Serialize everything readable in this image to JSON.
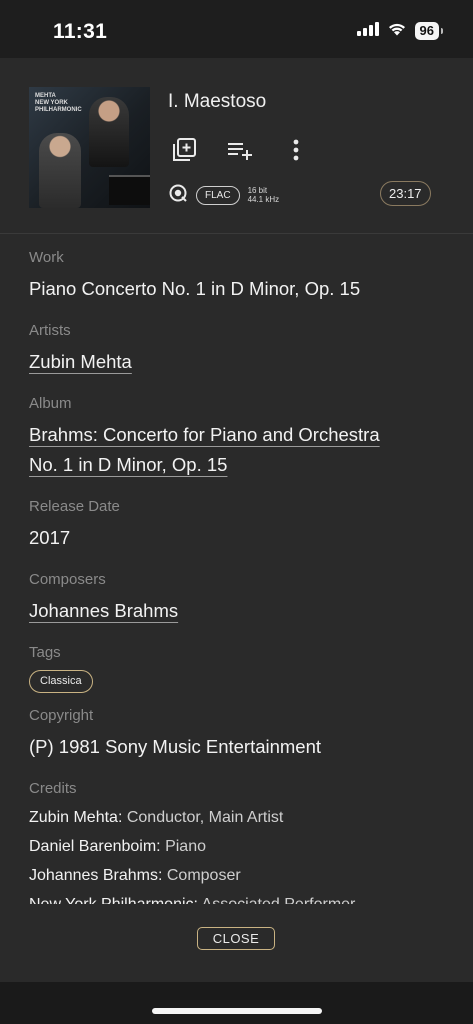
{
  "status_bar": {
    "time": "11:31",
    "battery": "96"
  },
  "track": {
    "title": "I. Maestoso",
    "format": "FLAC",
    "bit_depth": "16 bit",
    "sample_rate": "44.1 kHz",
    "duration": "23:17",
    "album_art_text": "MEHTA NEW YORK PHILHARMONIC BARENBOIM BRAHMS PIANO CONCERTO 1"
  },
  "details": {
    "work": {
      "label": "Work",
      "value": "Piano Concerto No. 1 in D Minor, Op. 15"
    },
    "artists": {
      "label": "Artists",
      "value": "Zubin Mehta"
    },
    "album": {
      "label": "Album",
      "value_line1": "Brahms: Concerto for Piano and Orchestra",
      "value_line2": "No. 1 in D Minor, Op. 15"
    },
    "release_date": {
      "label": "Release Date",
      "value": "2017"
    },
    "composers": {
      "label": "Composers",
      "value": "Johannes Brahms"
    },
    "tags": {
      "label": "Tags",
      "items": [
        "Classica"
      ]
    },
    "copyright": {
      "label": "Copyright",
      "value": "(P) 1981 Sony Music Entertainment"
    },
    "credits": {
      "label": "Credits",
      "items": [
        {
          "name": "Zubin Mehta:",
          "role": "Conductor, Main Artist"
        },
        {
          "name": "Daniel Barenboim:",
          "role": "Piano"
        },
        {
          "name": "Johannes Brahms:",
          "role": "Composer"
        },
        {
          "name": "New York Philharmonic:",
          "role": "Associated Performer"
        }
      ]
    }
  },
  "close_button": "CLOSE",
  "colors": {
    "background": "#2a2a2a",
    "accent_gold": "#c9b383",
    "label_gray": "#8a8a8a",
    "text": "#f2f2f2"
  },
  "icons": {
    "add_to_playlist": "library-add-icon",
    "add_to_queue": "playlist-add-icon",
    "more": "more-vertical-icon",
    "quality": "hi-res-disc-icon"
  }
}
